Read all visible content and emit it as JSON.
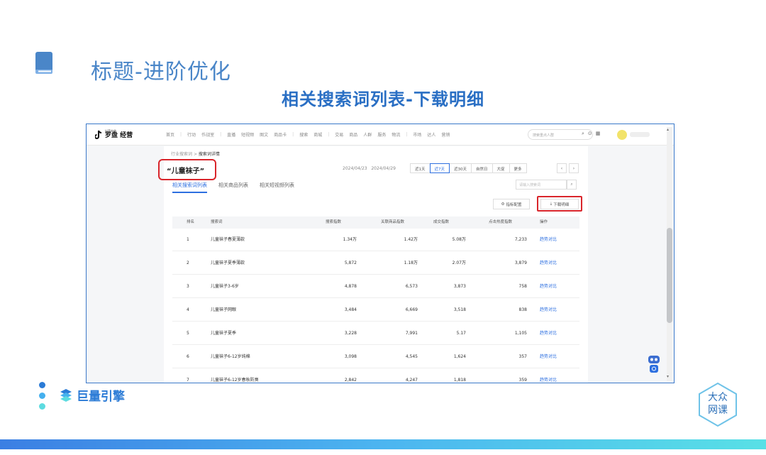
{
  "slide": {
    "title": "标题-进阶优化",
    "subtitle": "相关搜索词列表-下载明细"
  },
  "app": {
    "logo_small": "抖音电商",
    "logo_big": "罗盘 经营",
    "nav": [
      "首页",
      "|",
      "行动",
      "作战室",
      "|",
      "直播",
      "短视频",
      "图文",
      "商品卡",
      "|",
      "搜索",
      "商城",
      "|",
      "交易",
      "商品",
      "人群",
      "服务",
      "物流",
      "|",
      "市场",
      "达人",
      "营销"
    ],
    "search_placeholder": "搜索重点人群",
    "breadcrumb_parent": "行业搜索词",
    "breadcrumb_current": "搜索词详情",
    "keyword": "“儿童袜子”",
    "date_start": "2024/04/23",
    "date_end": "2024/04/29",
    "ranges": [
      "近1天",
      "近7天",
      "近30天",
      "自然日",
      "大促",
      "更多"
    ],
    "active_range": "近7天",
    "tabs": [
      "相关搜索词列表",
      "相关商品列表",
      "相关短视频列表"
    ],
    "table_search_placeholder": "请输入搜索词",
    "config_button": "指标配置",
    "download_button": "下载明细",
    "columns": [
      "排名",
      "搜索词",
      "搜索指数",
      "关联商品指数",
      "成交指数",
      "点击热度指数",
      "操作"
    ],
    "rows": [
      {
        "rank": "1",
        "keyword": "儿童袜子春夏薄款",
        "v1": "1.34万",
        "v2": "1.42万",
        "v3": "5.08万",
        "v4": "7,233",
        "op": "趋势对比"
      },
      {
        "rank": "2",
        "keyword": "儿童袜子夏季薄款",
        "v1": "5,872",
        "v2": "1.18万",
        "v3": "2.07万",
        "v4": "3,879",
        "op": "趋势对比"
      },
      {
        "rank": "3",
        "keyword": "儿童袜子3-6岁",
        "v1": "4,878",
        "v2": "6,573",
        "v3": "3,873",
        "v4": "758",
        "op": "趋势对比"
      },
      {
        "rank": "4",
        "keyword": "儿童袜子网眼",
        "v1": "3,484",
        "v2": "6,669",
        "v3": "3,518",
        "v4": "838",
        "op": "趋势对比"
      },
      {
        "rank": "5",
        "keyword": "儿童袜子夏季",
        "v1": "3,228",
        "v2": "7,991",
        "v3": "5.17",
        "v4": "1,105",
        "op": "趋势对比"
      },
      {
        "rank": "6",
        "keyword": "儿童袜子6-12岁纯棉",
        "v1": "3,098",
        "v2": "4,545",
        "v3": "1,624",
        "v4": "357",
        "op": "趋势对比"
      },
      {
        "rank": "7",
        "keyword": "儿童袜子6-12岁春秋防臭",
        "v1": "2,842",
        "v2": "4,247",
        "v3": "1,818",
        "v4": "359",
        "op": "趋势对比"
      }
    ]
  },
  "footer": {
    "brand": "巨量引擎",
    "right_logo_line1": "大众",
    "right_logo_line2": "网课"
  },
  "colors": {
    "title_blue": "#4a86c8",
    "subtitle_blue": "#2a6fc4",
    "highlight_red": "#d9252b",
    "link_blue": "#2d6fe0"
  }
}
